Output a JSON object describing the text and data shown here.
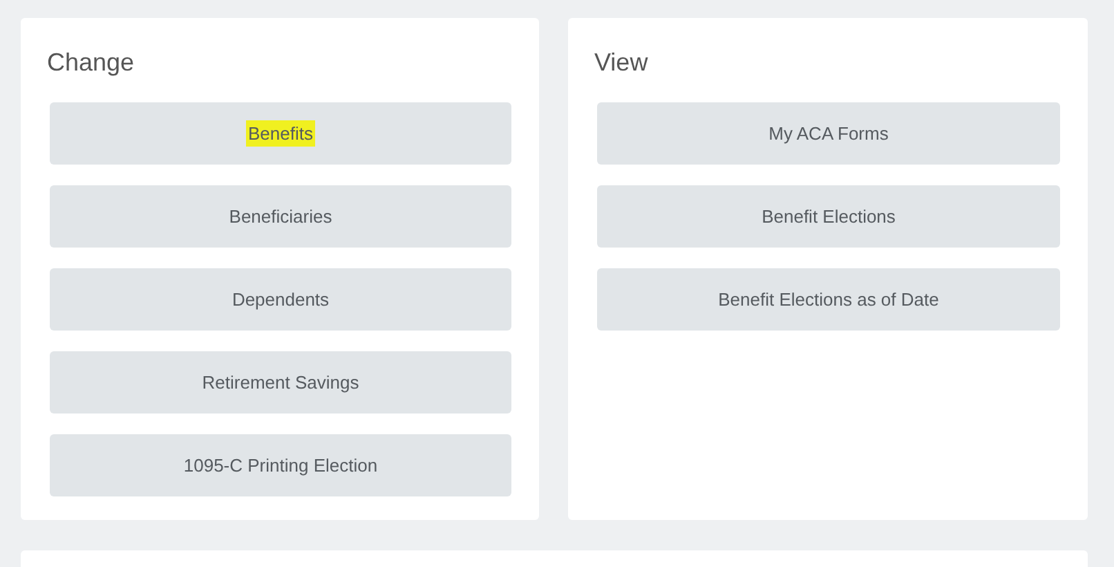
{
  "panels": [
    {
      "title": "Change",
      "actions": [
        {
          "label": "Benefits",
          "highlighted": true
        },
        {
          "label": "Beneficiaries",
          "highlighted": false
        },
        {
          "label": "Dependents",
          "highlighted": false
        },
        {
          "label": "Retirement Savings",
          "highlighted": false
        },
        {
          "label": "1095-C Printing Election",
          "highlighted": false
        }
      ]
    },
    {
      "title": "View",
      "actions": [
        {
          "label": "My ACA Forms",
          "highlighted": false
        },
        {
          "label": "Benefit Elections",
          "highlighted": false
        },
        {
          "label": "Benefit Elections as of Date",
          "highlighted": false
        }
      ]
    }
  ]
}
